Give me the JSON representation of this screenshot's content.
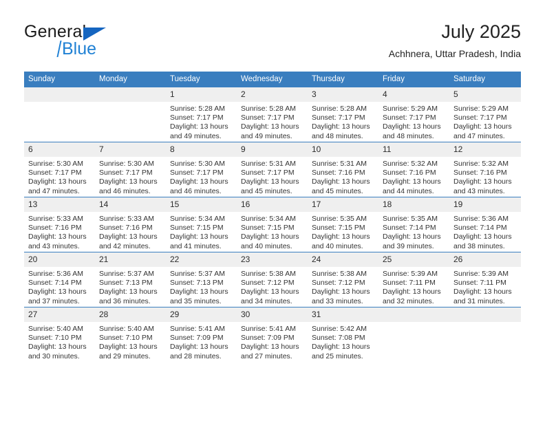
{
  "brand": {
    "name_part1": "General",
    "name_part2": "Blue",
    "triangle_color": "#1565c0",
    "blue_color": "#2081d4"
  },
  "header": {
    "title": "July 2025",
    "subtitle": "Achhnera, Uttar Pradesh, India"
  },
  "theme": {
    "header_blue": "#3a7ebf",
    "daynum_gray": "#efefef"
  },
  "weekdays": [
    "Sunday",
    "Monday",
    "Tuesday",
    "Wednesday",
    "Thursday",
    "Friday",
    "Saturday"
  ],
  "labels": {
    "sunrise": "Sunrise:",
    "sunset": "Sunset:",
    "daylight": "Daylight:"
  },
  "weeks": [
    [
      {
        "day": "",
        "empty": true
      },
      {
        "day": "",
        "empty": true
      },
      {
        "day": "1",
        "sunrise": "Sunrise: 5:28 AM",
        "sunset": "Sunset: 7:17 PM",
        "daylight": "Daylight: 13 hours and 49 minutes."
      },
      {
        "day": "2",
        "sunrise": "Sunrise: 5:28 AM",
        "sunset": "Sunset: 7:17 PM",
        "daylight": "Daylight: 13 hours and 49 minutes."
      },
      {
        "day": "3",
        "sunrise": "Sunrise: 5:28 AM",
        "sunset": "Sunset: 7:17 PM",
        "daylight": "Daylight: 13 hours and 48 minutes."
      },
      {
        "day": "4",
        "sunrise": "Sunrise: 5:29 AM",
        "sunset": "Sunset: 7:17 PM",
        "daylight": "Daylight: 13 hours and 48 minutes."
      },
      {
        "day": "5",
        "sunrise": "Sunrise: 5:29 AM",
        "sunset": "Sunset: 7:17 PM",
        "daylight": "Daylight: 13 hours and 47 minutes."
      }
    ],
    [
      {
        "day": "6",
        "sunrise": "Sunrise: 5:30 AM",
        "sunset": "Sunset: 7:17 PM",
        "daylight": "Daylight: 13 hours and 47 minutes."
      },
      {
        "day": "7",
        "sunrise": "Sunrise: 5:30 AM",
        "sunset": "Sunset: 7:17 PM",
        "daylight": "Daylight: 13 hours and 46 minutes."
      },
      {
        "day": "8",
        "sunrise": "Sunrise: 5:30 AM",
        "sunset": "Sunset: 7:17 PM",
        "daylight": "Daylight: 13 hours and 46 minutes."
      },
      {
        "day": "9",
        "sunrise": "Sunrise: 5:31 AM",
        "sunset": "Sunset: 7:17 PM",
        "daylight": "Daylight: 13 hours and 45 minutes."
      },
      {
        "day": "10",
        "sunrise": "Sunrise: 5:31 AM",
        "sunset": "Sunset: 7:16 PM",
        "daylight": "Daylight: 13 hours and 45 minutes."
      },
      {
        "day": "11",
        "sunrise": "Sunrise: 5:32 AM",
        "sunset": "Sunset: 7:16 PM",
        "daylight": "Daylight: 13 hours and 44 minutes."
      },
      {
        "day": "12",
        "sunrise": "Sunrise: 5:32 AM",
        "sunset": "Sunset: 7:16 PM",
        "daylight": "Daylight: 13 hours and 43 minutes."
      }
    ],
    [
      {
        "day": "13",
        "sunrise": "Sunrise: 5:33 AM",
        "sunset": "Sunset: 7:16 PM",
        "daylight": "Daylight: 13 hours and 43 minutes."
      },
      {
        "day": "14",
        "sunrise": "Sunrise: 5:33 AM",
        "sunset": "Sunset: 7:16 PM",
        "daylight": "Daylight: 13 hours and 42 minutes."
      },
      {
        "day": "15",
        "sunrise": "Sunrise: 5:34 AM",
        "sunset": "Sunset: 7:15 PM",
        "daylight": "Daylight: 13 hours and 41 minutes."
      },
      {
        "day": "16",
        "sunrise": "Sunrise: 5:34 AM",
        "sunset": "Sunset: 7:15 PM",
        "daylight": "Daylight: 13 hours and 40 minutes."
      },
      {
        "day": "17",
        "sunrise": "Sunrise: 5:35 AM",
        "sunset": "Sunset: 7:15 PM",
        "daylight": "Daylight: 13 hours and 40 minutes."
      },
      {
        "day": "18",
        "sunrise": "Sunrise: 5:35 AM",
        "sunset": "Sunset: 7:14 PM",
        "daylight": "Daylight: 13 hours and 39 minutes."
      },
      {
        "day": "19",
        "sunrise": "Sunrise: 5:36 AM",
        "sunset": "Sunset: 7:14 PM",
        "daylight": "Daylight: 13 hours and 38 minutes."
      }
    ],
    [
      {
        "day": "20",
        "sunrise": "Sunrise: 5:36 AM",
        "sunset": "Sunset: 7:14 PM",
        "daylight": "Daylight: 13 hours and 37 minutes."
      },
      {
        "day": "21",
        "sunrise": "Sunrise: 5:37 AM",
        "sunset": "Sunset: 7:13 PM",
        "daylight": "Daylight: 13 hours and 36 minutes."
      },
      {
        "day": "22",
        "sunrise": "Sunrise: 5:37 AM",
        "sunset": "Sunset: 7:13 PM",
        "daylight": "Daylight: 13 hours and 35 minutes."
      },
      {
        "day": "23",
        "sunrise": "Sunrise: 5:38 AM",
        "sunset": "Sunset: 7:12 PM",
        "daylight": "Daylight: 13 hours and 34 minutes."
      },
      {
        "day": "24",
        "sunrise": "Sunrise: 5:38 AM",
        "sunset": "Sunset: 7:12 PM",
        "daylight": "Daylight: 13 hours and 33 minutes."
      },
      {
        "day": "25",
        "sunrise": "Sunrise: 5:39 AM",
        "sunset": "Sunset: 7:11 PM",
        "daylight": "Daylight: 13 hours and 32 minutes."
      },
      {
        "day": "26",
        "sunrise": "Sunrise: 5:39 AM",
        "sunset": "Sunset: 7:11 PM",
        "daylight": "Daylight: 13 hours and 31 minutes."
      }
    ],
    [
      {
        "day": "27",
        "sunrise": "Sunrise: 5:40 AM",
        "sunset": "Sunset: 7:10 PM",
        "daylight": "Daylight: 13 hours and 30 minutes."
      },
      {
        "day": "28",
        "sunrise": "Sunrise: 5:40 AM",
        "sunset": "Sunset: 7:10 PM",
        "daylight": "Daylight: 13 hours and 29 minutes."
      },
      {
        "day": "29",
        "sunrise": "Sunrise: 5:41 AM",
        "sunset": "Sunset: 7:09 PM",
        "daylight": "Daylight: 13 hours and 28 minutes."
      },
      {
        "day": "30",
        "sunrise": "Sunrise: 5:41 AM",
        "sunset": "Sunset: 7:09 PM",
        "daylight": "Daylight: 13 hours and 27 minutes."
      },
      {
        "day": "31",
        "sunrise": "Sunrise: 5:42 AM",
        "sunset": "Sunset: 7:08 PM",
        "daylight": "Daylight: 13 hours and 25 minutes."
      },
      {
        "day": "",
        "empty": true
      },
      {
        "day": "",
        "empty": true
      }
    ]
  ]
}
